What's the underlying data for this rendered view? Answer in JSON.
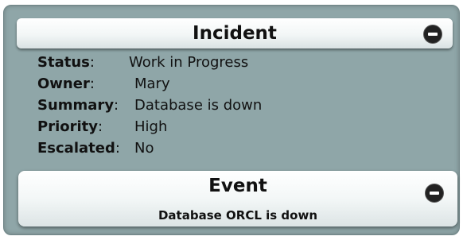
{
  "incident": {
    "title": "Incident",
    "collapse_icon": "minus-circle-icon",
    "fields": [
      {
        "label": "Status",
        "value": "Work in Progress"
      },
      {
        "label": "Owner",
        "value": "Mary"
      },
      {
        "label": "Summary",
        "value": "Database is down"
      },
      {
        "label": "Priority",
        "value": "High"
      },
      {
        "label": "Escalated",
        "value": "No"
      }
    ]
  },
  "event": {
    "title": "Event",
    "description": "Database ORCL is down",
    "collapse_icon": "minus-circle-icon"
  },
  "colors": {
    "panel_bg": "#8fa6a8",
    "text": "#111111",
    "button_bg": "#222222"
  }
}
